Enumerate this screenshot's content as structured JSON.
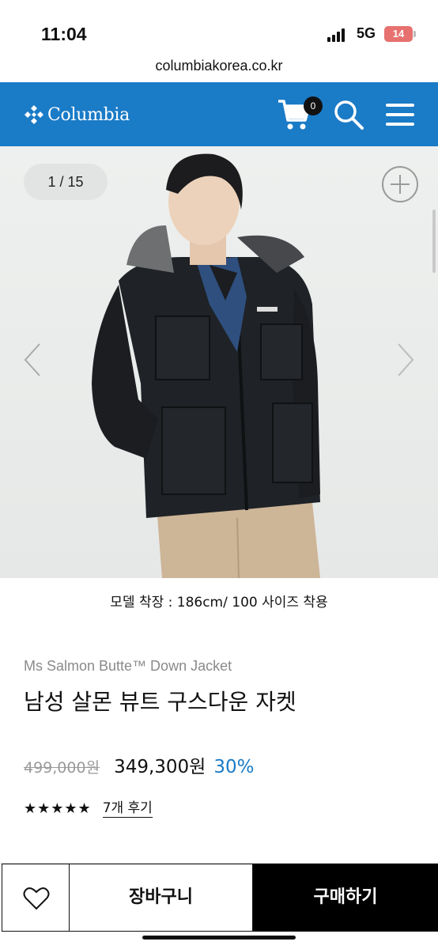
{
  "status_bar": {
    "time": "11:04",
    "network": "5G",
    "battery": "14"
  },
  "browser": {
    "url": "columbiakorea.co.kr"
  },
  "header": {
    "logo_text": "Columbia",
    "cart_count": "0",
    "icons": [
      "cart-icon",
      "search-icon",
      "menu-icon"
    ],
    "color": "#1a7bc7"
  },
  "gallery": {
    "counter": "1 / 15",
    "current_image": 1,
    "total_images": 15,
    "caption": "모델 착장 : 186cm/ 100 사이즈 착용"
  },
  "product": {
    "english_name": "Ms Salmon Butte™ Down Jacket",
    "korean_name": "남성 살몬 뷰트 구스다운 자켓",
    "original_price": "499,000원",
    "sale_price": "349,300원",
    "discount": "30%",
    "rating": 5,
    "stars": "★★★★★",
    "reviews": "7개 후기"
  },
  "actions": {
    "wishlist_icon": "heart-icon",
    "cart_label": "장바구니",
    "buy_label": "구매하기"
  }
}
